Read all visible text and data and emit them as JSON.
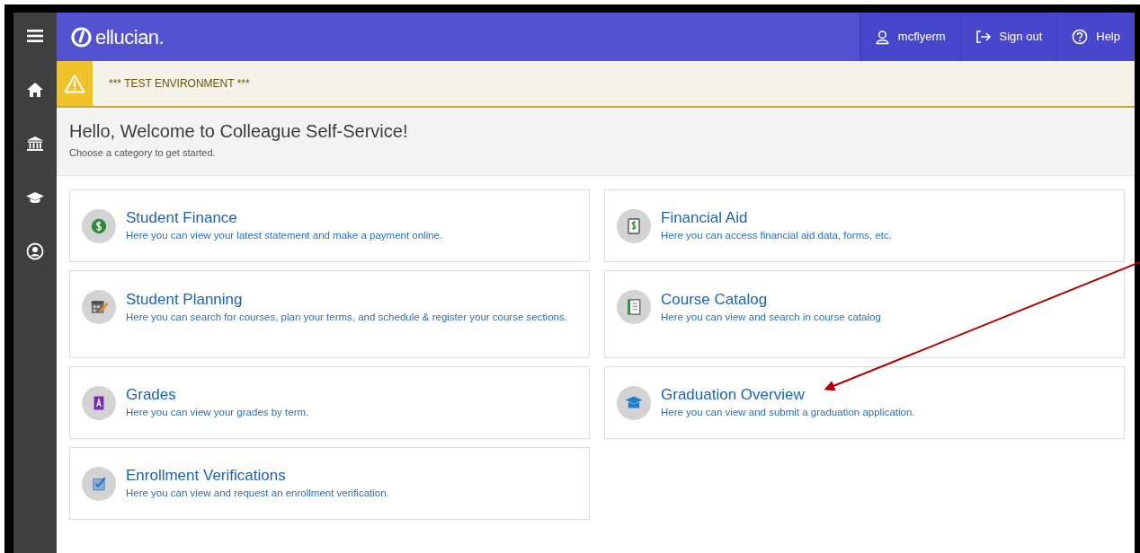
{
  "header": {
    "logo": "ellucian.",
    "actions": [
      {
        "kind": "user",
        "label": "mcflyerm"
      },
      {
        "kind": "signout",
        "label": "Sign out"
      },
      {
        "kind": "help",
        "label": "Help"
      }
    ]
  },
  "sidebar": {
    "items": [
      {
        "kind": "menu"
      },
      {
        "kind": "home"
      },
      {
        "kind": "bank"
      },
      {
        "kind": "cap"
      },
      {
        "kind": "user"
      }
    ]
  },
  "banner": {
    "text": "*** TEST ENVIRONMENT ***"
  },
  "welcome": {
    "title": "Hello, Welcome to Colleague Self-Service!",
    "subtitle": "Choose a category to get started."
  },
  "categories": [
    {
      "kind": "finance",
      "title": "Student Finance",
      "description": "Here you can view your latest statement and make a payment online."
    },
    {
      "kind": "aid",
      "title": "Financial Aid",
      "description": "Here you can access financial aid data, forms, etc."
    },
    {
      "kind": "planning",
      "title": "Student Planning",
      "description": "Here you can search for courses, plan your terms, and schedule & register your course sections."
    },
    {
      "kind": "catalog",
      "title": "Course Catalog",
      "description": "Here you can view and search in course catalog"
    },
    {
      "kind": "grades",
      "title": "Grades",
      "description": "Here you can view your grades by term."
    },
    {
      "kind": "graduation",
      "title": "Graduation Overview",
      "description": "Here you can view and submit a graduation application."
    },
    {
      "kind": "enrollment",
      "title": "Enrollment Verifications",
      "description": "Here you can view and request an enrollment verification."
    }
  ]
}
